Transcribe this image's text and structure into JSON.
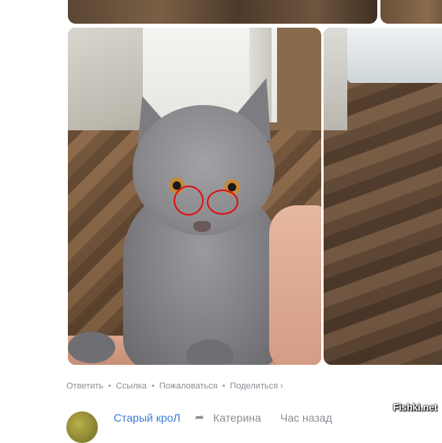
{
  "post": {
    "photos": [
      {
        "label": "top-left-photo"
      },
      {
        "label": "top-right-photo"
      },
      {
        "label": "kitten-photo"
      },
      {
        "label": "floor-photo"
      }
    ],
    "annotation_color": "#e01010"
  },
  "actions": {
    "reply": "Ответить",
    "link": "Ссылка",
    "report": "Пожаловаться",
    "share": "Поделиться",
    "separator": "•",
    "chevron": "›"
  },
  "comment": {
    "author": "Старый кроЛ",
    "reply_icon": "reply-arrow-icon",
    "reply_to": "Катерина",
    "time": "Час назад"
  },
  "watermark": "Fishki.net",
  "colors": {
    "link": "#3b7dd8",
    "muted": "#8a8f95"
  }
}
